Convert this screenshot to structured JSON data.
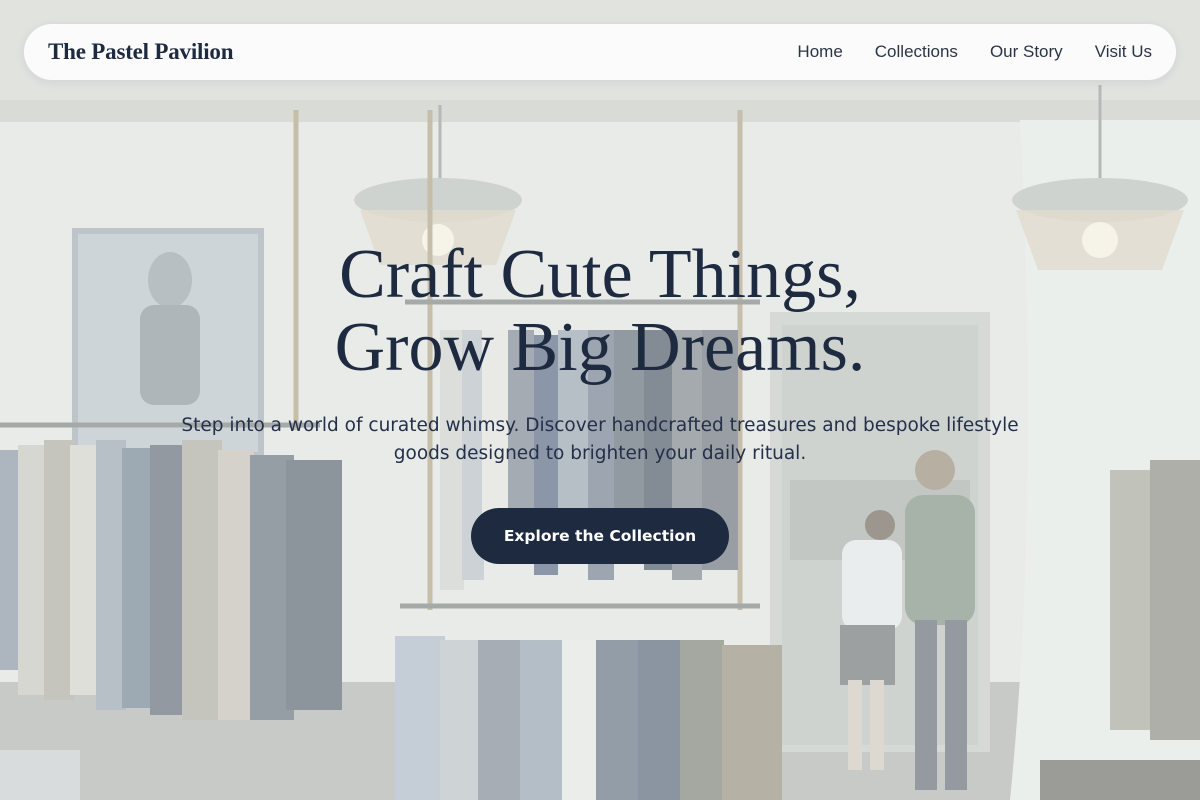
{
  "brand": {
    "name": "The Pastel Pavilion"
  },
  "nav": {
    "links": [
      {
        "label": "Home"
      },
      {
        "label": "Collections"
      },
      {
        "label": "Our Story"
      },
      {
        "label": "Visit Us"
      }
    ]
  },
  "hero": {
    "title_line1": "Craft Cute Things,",
    "title_line2": "Grow Big Dreams.",
    "subtitle": "Step into a world of curated whimsy. Discover handcrafted treasures and bespoke lifestyle goods designed to brighten your daily ritual.",
    "cta_label": "Explore the Collection"
  },
  "background": {
    "description_icon": "clothing-store-photo"
  },
  "colors": {
    "primary": "#1e2a40",
    "navbar_bg": "#ffffff",
    "text": "#1e2a40",
    "cta_text": "#ffffff"
  }
}
